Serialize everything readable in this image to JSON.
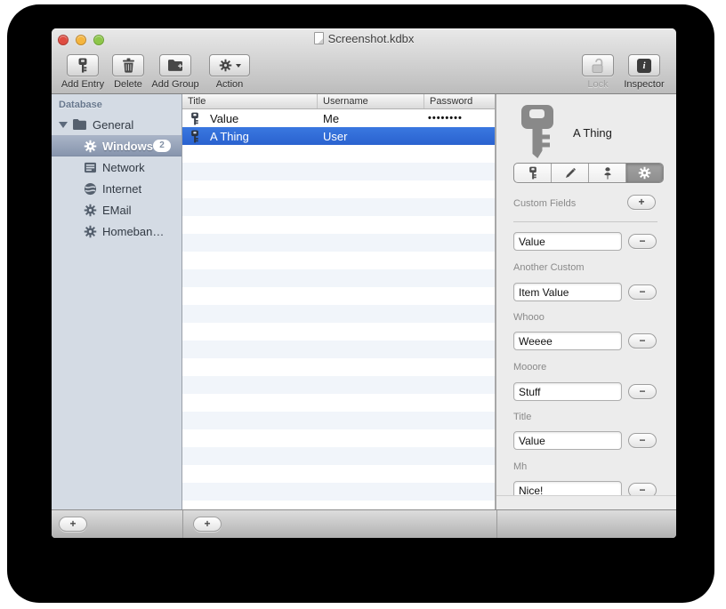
{
  "window": {
    "title": "Screenshot.kdbx"
  },
  "toolbar": {
    "items": [
      {
        "label": "Add Entry",
        "icon": "key-icon"
      },
      {
        "label": "Delete",
        "icon": "trash-icon"
      },
      {
        "label": "Add Group",
        "icon": "folder-plus-icon"
      },
      {
        "label": "Action",
        "icon": "gear-dropdown-icon"
      },
      {
        "label": "Lock",
        "icon": "padlock-open-icon",
        "disabled": true
      },
      {
        "label": "Inspector",
        "icon": "info-icon"
      }
    ]
  },
  "sidebar": {
    "header": "Database",
    "items": [
      {
        "label": "General",
        "icon": "folder",
        "expanded": true
      },
      {
        "label": "Windows",
        "icon": "gear",
        "badge": "2",
        "selected": true
      },
      {
        "label": "Network",
        "icon": "server"
      },
      {
        "label": "Internet",
        "icon": "globe"
      },
      {
        "label": "EMail",
        "icon": "gear"
      },
      {
        "label": "Homeban…",
        "icon": "gear"
      }
    ]
  },
  "entries_table": {
    "columns": [
      "Title",
      "Username",
      "Password"
    ],
    "rows": [
      {
        "icon": "key",
        "title": "Value",
        "username": "Me",
        "password": "••••••••"
      },
      {
        "icon": "key",
        "title": "A Thing",
        "username": "User",
        "password": "",
        "selected": true
      }
    ]
  },
  "inspector": {
    "entry_icon": "key",
    "entry_title": "A Thing",
    "tabs": [
      {
        "icon": "key"
      },
      {
        "icon": "pencil"
      },
      {
        "icon": "pushpin"
      },
      {
        "icon": "gear",
        "selected": true
      }
    ],
    "section_title": "Custom Fields",
    "add_button": "+",
    "fields": [
      {
        "label": "",
        "value": "Value",
        "remove": "−"
      },
      {
        "label": "Another Custom",
        "value": "Item Value",
        "remove": "−"
      },
      {
        "label": "Whooo",
        "value": "Weeee",
        "remove": "−"
      },
      {
        "label": "Mooore",
        "value": "Stuff",
        "remove": "−"
      },
      {
        "label": "Title",
        "value": "Value",
        "remove": "−"
      },
      {
        "label": "Mh",
        "value": "Nice!",
        "remove": "−"
      }
    ]
  },
  "bottom_bar": {
    "sidebar_add": "+",
    "entries_add": "+"
  },
  "colors": {
    "selection_blue": "#2f6fdd",
    "sidebar_selection": "#93a1b8",
    "toolbar_gray": "#c9c9c9"
  }
}
